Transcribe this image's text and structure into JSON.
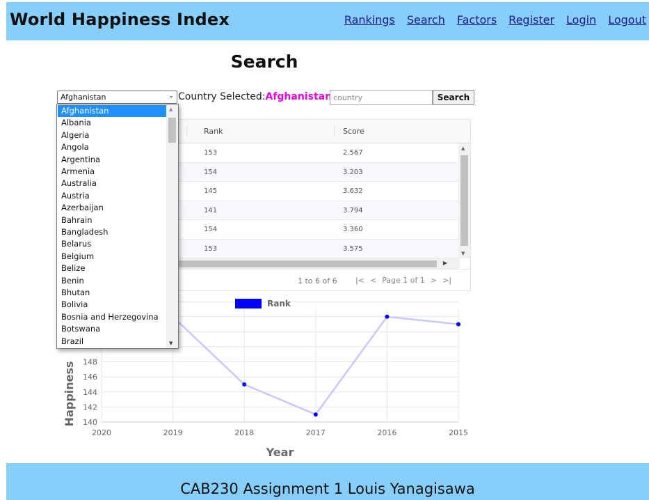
{
  "header": {
    "brand": "World Happiness Index",
    "nav": [
      "Rankings",
      "Search",
      "Factors",
      "Register",
      "Login",
      "Logout"
    ]
  },
  "page_title": "Search",
  "controls": {
    "selected_country": "Afghanistan",
    "country_label": "Country Selected:",
    "country_value": "Afghanistan",
    "search_placeholder": "country",
    "search_button": "Search"
  },
  "dropdown": {
    "options": [
      "Afghanistan",
      "Albania",
      "Algeria",
      "Angola",
      "Argentina",
      "Armenia",
      "Australia",
      "Austria",
      "Azerbaijan",
      "Bahrain",
      "Bangladesh",
      "Belarus",
      "Belgium",
      "Belize",
      "Benin",
      "Bhutan",
      "Bolivia",
      "Bosnia and Herzegovina",
      "Botswana",
      "Brazil"
    ],
    "selected_index": 0
  },
  "grid": {
    "columns": [
      "Rank",
      "Score"
    ],
    "rows": [
      {
        "rank": "153",
        "score": "2.567"
      },
      {
        "rank": "154",
        "score": "3.203"
      },
      {
        "rank": "145",
        "score": "3.632"
      },
      {
        "rank": "141",
        "score": "3.794"
      },
      {
        "rank": "154",
        "score": "3.360"
      },
      {
        "rank": "153",
        "score": "3.575"
      }
    ],
    "summary": "1 to 6 of 6",
    "page_label": "Page 1 of 1"
  },
  "chart_data": {
    "type": "line",
    "x": [
      "2020",
      "2019",
      "2018",
      "2017",
      "2016",
      "2015"
    ],
    "series": [
      {
        "name": "Rank",
        "values": [
          153,
          154,
          145,
          141,
          154,
          153
        ],
        "color": "#0000ff"
      }
    ],
    "xlabel": "Year",
    "ylabel": "Happiness",
    "y_ticks": [
      140,
      142,
      144,
      146,
      148
    ],
    "ylim": [
      140,
      156
    ],
    "grid": true,
    "legend": "top"
  },
  "footer": {
    "text": "CAB230 Assignment 1 Louis Yanagisawa"
  }
}
